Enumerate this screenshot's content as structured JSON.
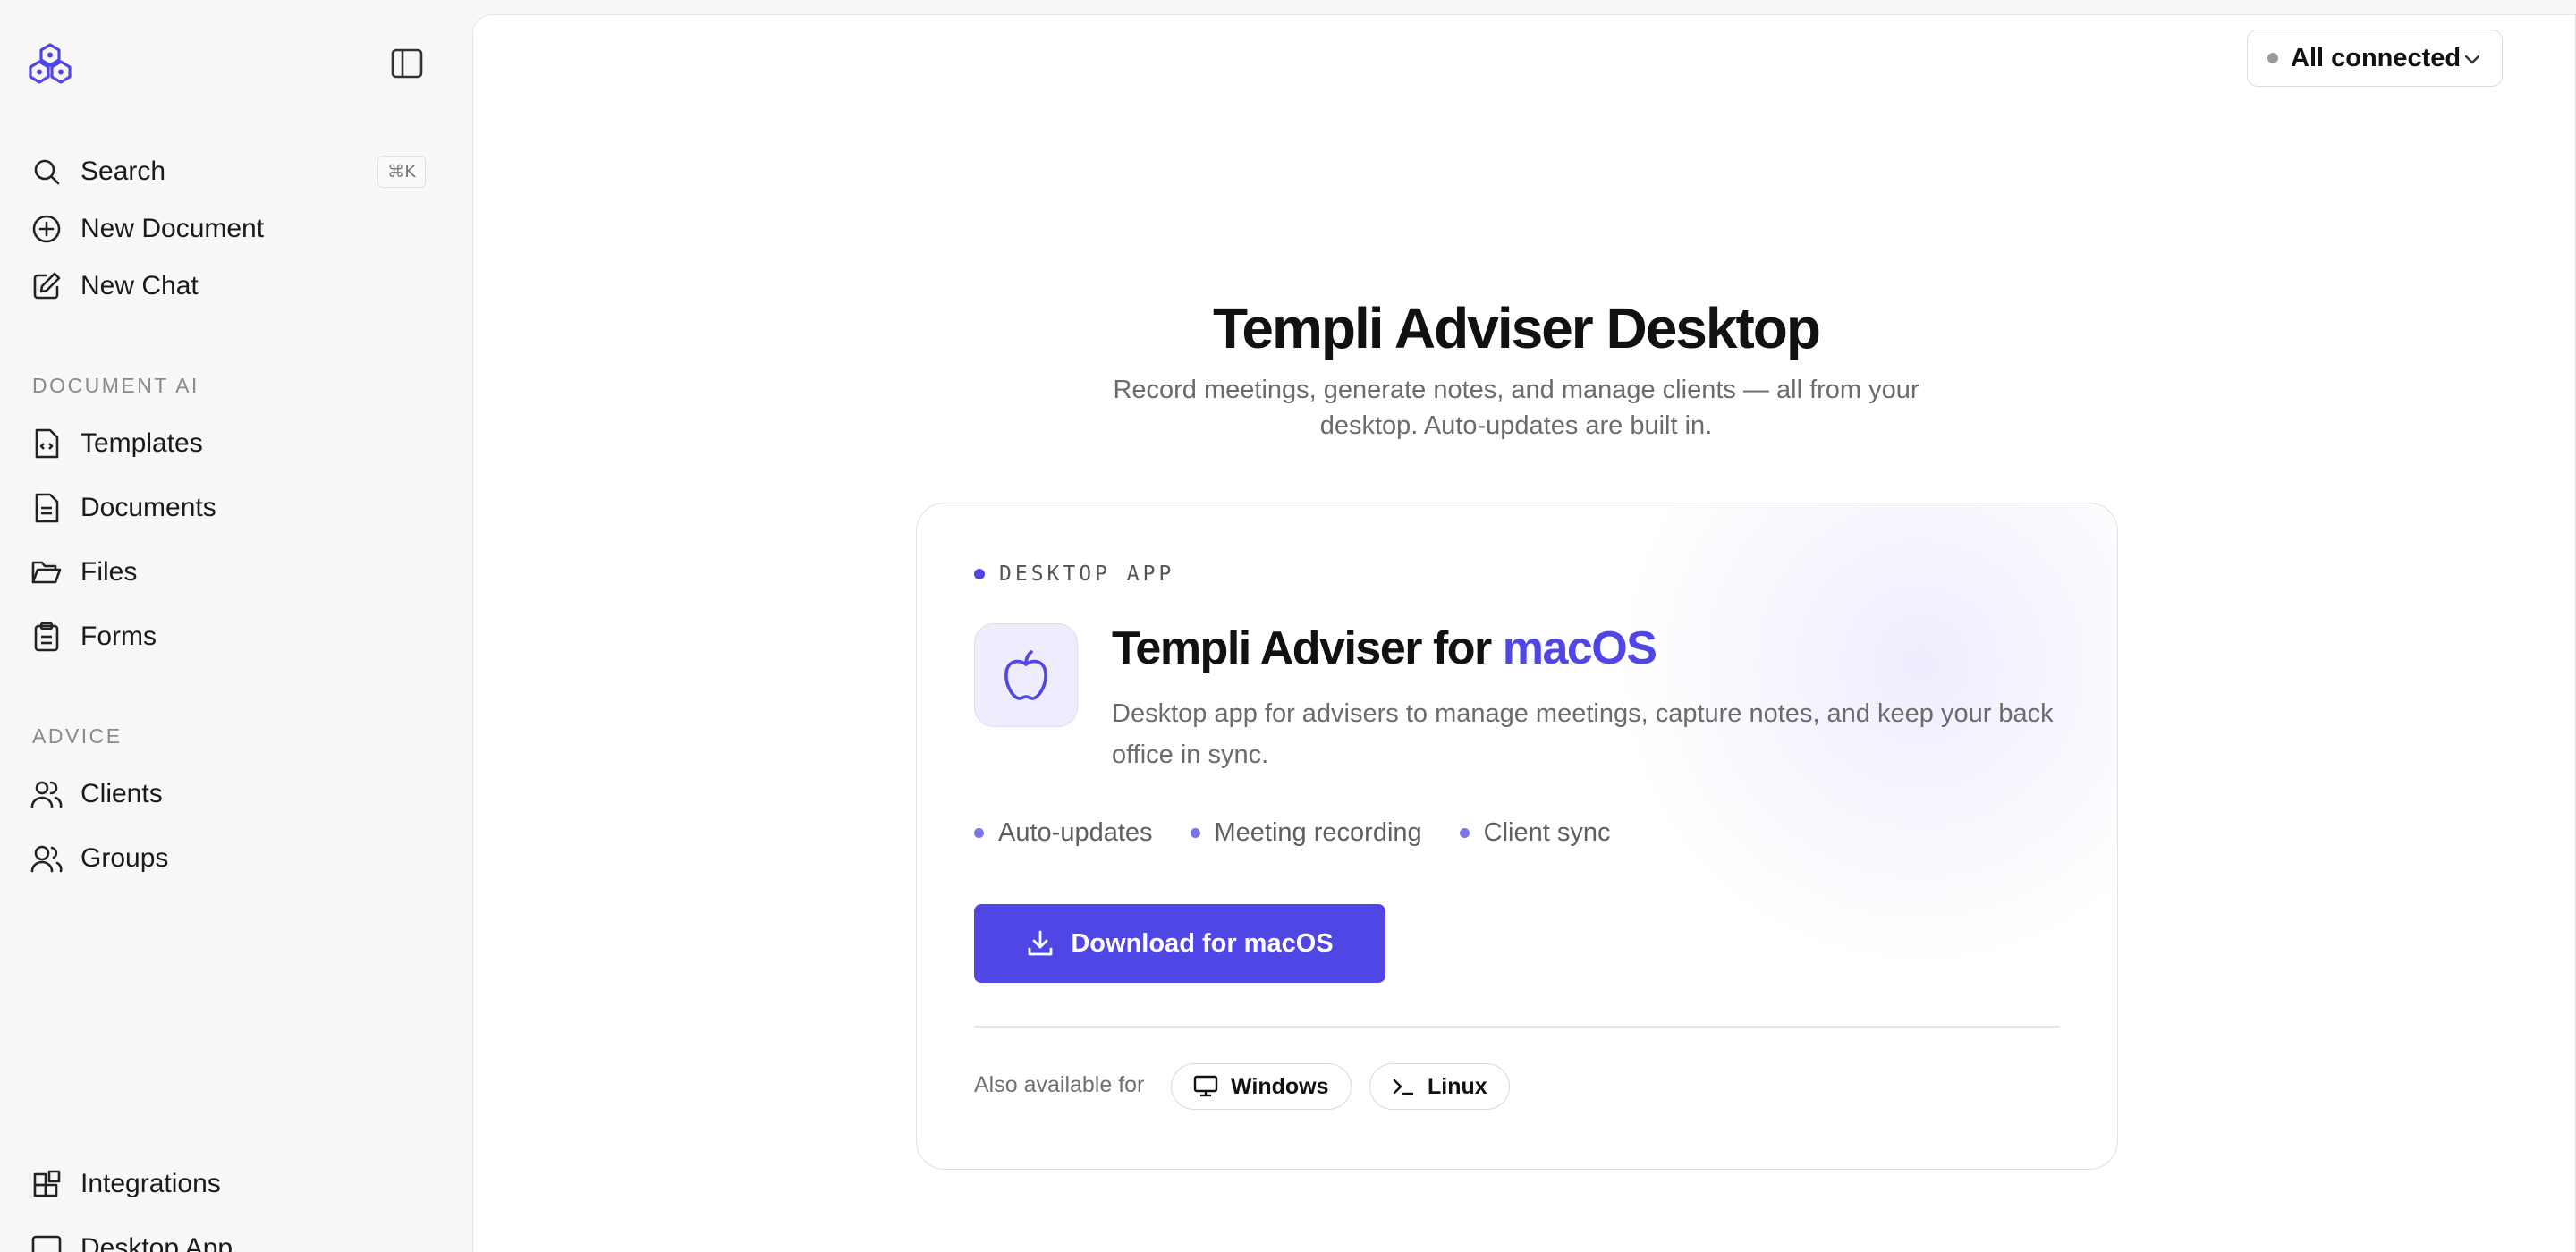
{
  "sidebar": {
    "search_label": "Search",
    "search_shortcut": "⌘K",
    "new_document_label": "New Document",
    "new_chat_label": "New Chat",
    "section_document_ai": "DOCUMENT AI",
    "templates_label": "Templates",
    "documents_label": "Documents",
    "files_label": "Files",
    "forms_label": "Forms",
    "section_advice": "ADVICE",
    "clients_label": "Clients",
    "groups_label": "Groups",
    "integrations_label": "Integrations",
    "desktop_app_label": "Desktop App"
  },
  "header": {
    "connection_status": "All connected"
  },
  "hero": {
    "title": "Templi Adviser Desktop",
    "subtitle": "Record meetings, generate notes, and manage clients — all from your desktop. Auto-updates are built in."
  },
  "card": {
    "eyebrow": "DESKTOP APP",
    "title_prefix": "Templi Adviser for ",
    "title_platform": "macOS",
    "description": "Desktop app for advisers to manage meetings, capture notes, and keep your back office in sync.",
    "features": [
      "Auto-updates",
      "Meeting recording",
      "Client sync"
    ],
    "download_label": "Download for macOS",
    "also_available_label": "Also available for",
    "alt_platforms": [
      "Windows",
      "Linux"
    ]
  },
  "colors": {
    "accent": "#4f46e5",
    "accent_text": "#5046e5",
    "icon_bg": "#eeecfd"
  }
}
